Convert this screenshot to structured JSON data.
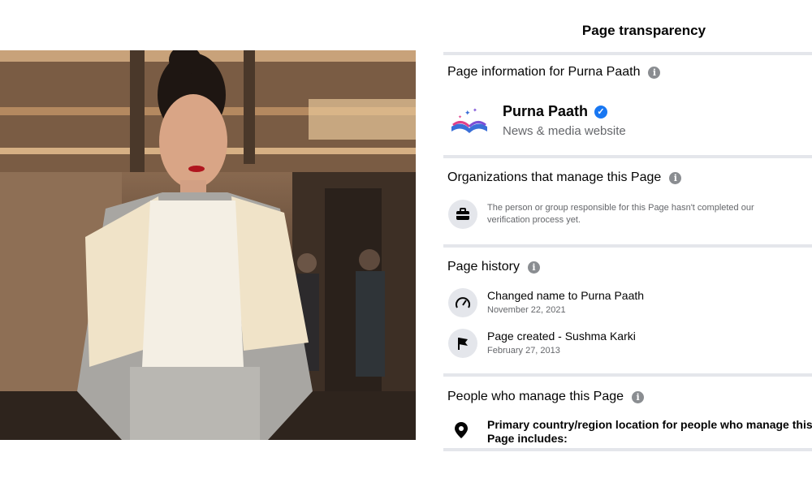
{
  "panel": {
    "title": "Page transparency",
    "page_info": {
      "heading": "Page information for Purna Paath",
      "page_name": "Purna Paath",
      "category": "News & media website",
      "logo_icon": "book-stars-icon"
    },
    "organizations": {
      "heading": "Organizations that manage this Page",
      "message": "The person or group responsible for this Page hasn't completed our verification process yet."
    },
    "history": {
      "heading": "Page history",
      "items": [
        {
          "title": "Changed name to Purna Paath",
          "date": "November 22, 2021",
          "icon": "speedometer-icon"
        },
        {
          "title": "Page created - Sushma Karki",
          "date": "February 27, 2013",
          "icon": "flag-icon"
        }
      ]
    },
    "people": {
      "heading": "People who manage this Page",
      "location_text": "Primary country/region location for people who manage this Page includes:"
    }
  },
  "colors": {
    "divider": "#e4e6eb",
    "verified_badge": "#1877f2",
    "secondary_text": "#65676b"
  }
}
